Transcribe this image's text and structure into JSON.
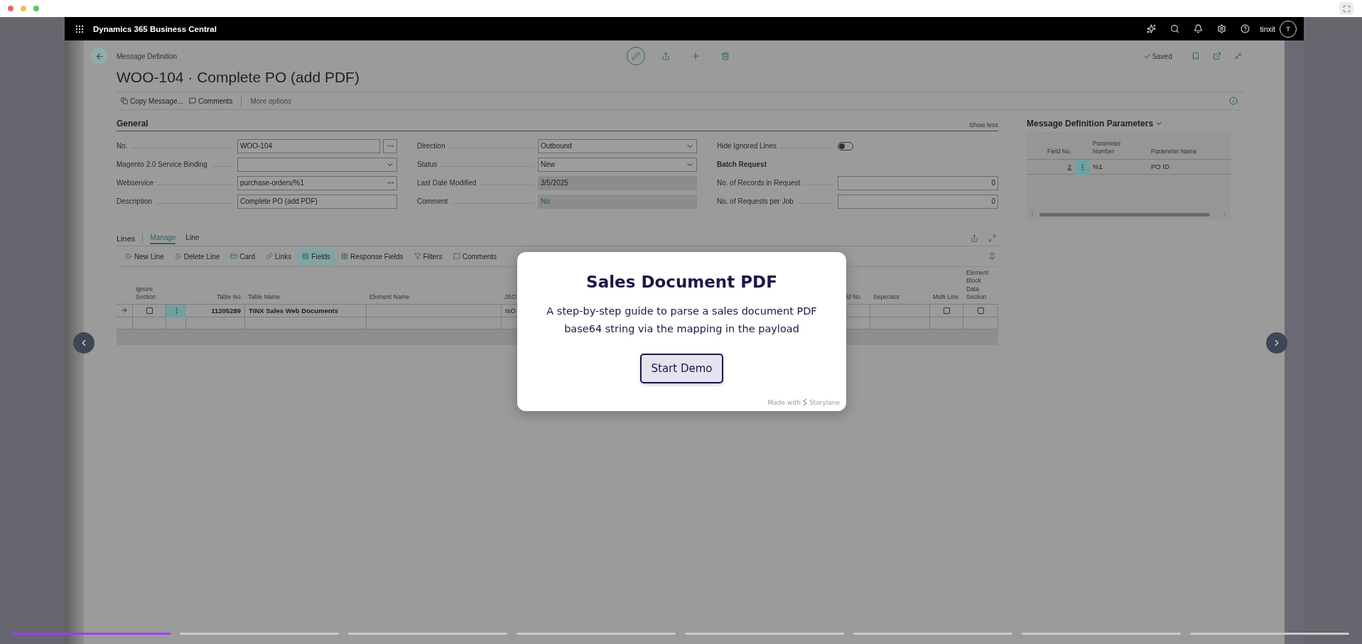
{
  "app_bar": {
    "title": "Dynamics 365 Business Central",
    "user": "tinxit",
    "avatar_initial": "T"
  },
  "page": {
    "breadcrumb": "Message Definition",
    "title": "WOO-104 · Complete PO (add PDF)",
    "status": "Saved"
  },
  "actions": [
    "Copy Message...",
    "Comments",
    "More options"
  ],
  "general": {
    "title": "General",
    "toggle_label": "Show less",
    "columns": [
      [
        {
          "label": "No.",
          "kind": "assist",
          "value": "WOO-104"
        },
        {
          "label": "Magento 2.0 Service Binding",
          "kind": "select"
        },
        {
          "label": "Webservice",
          "kind": "lookup",
          "value": "purchase-orders/%1"
        },
        {
          "label": "Description",
          "kind": "text",
          "value": "Complete PO (add PDF)"
        }
      ],
      [
        {
          "label": "Direction",
          "kind": "select",
          "value": "Outbound"
        },
        {
          "label": "Status",
          "kind": "select",
          "value": "New"
        },
        {
          "label": "Last Date Modified",
          "kind": "readonly",
          "value": "3/5/2025"
        },
        {
          "label": "Comment",
          "kind": "readonly_link",
          "value": "No"
        }
      ],
      [
        {
          "label": "Hide Ignored Lines",
          "kind": "toggle",
          "on": false
        },
        {
          "label": "Batch Request",
          "kind": "heading"
        },
        {
          "label": "No. of Records in Request",
          "kind": "number",
          "value": "0"
        },
        {
          "label": "No. of Requests per Job",
          "kind": "number",
          "value": "0"
        }
      ]
    ]
  },
  "lines": {
    "title": "Lines",
    "tabs": [
      {
        "label": "Manage",
        "selected": true
      },
      {
        "label": "Line",
        "selected": false
      }
    ],
    "actions": [
      {
        "label": "New Line",
        "selected": false
      },
      {
        "label": "Delete Line",
        "selected": false
      },
      {
        "label": "Card",
        "selected": false
      },
      {
        "label": "Links",
        "selected": false
      },
      {
        "label": "Fields",
        "selected": true
      },
      {
        "label": "Response Fields",
        "selected": false
      },
      {
        "label": "Filters",
        "selected": false
      },
      {
        "label": "Comments",
        "selected": false
      }
    ],
    "columns": [
      {
        "label": "Ignore Section",
        "kind": "check"
      },
      {
        "label": "Table No.",
        "kind": "number"
      },
      {
        "label": "Table Name",
        "kind": "strong"
      },
      {
        "label": "Element Name",
        "kind": "text"
      },
      {
        "label": "JSO",
        "kind": "text"
      },
      {
        "label": "ld No.",
        "kind": "text"
      },
      {
        "label": "Seperator",
        "kind": "text"
      },
      {
        "label": "Multi Line",
        "kind": "check"
      },
      {
        "label": "Element Block Data Section",
        "kind": "check"
      }
    ],
    "rows": [
      {
        "cells": [
          {
            "checked": false
          },
          {
            "text": "11205289"
          },
          {
            "text": "TINX Sales Web Documents"
          },
          {},
          {
            "text": "IsO"
          },
          {},
          {},
          {
            "checked": false
          },
          {
            "checked": false
          }
        ]
      }
    ]
  },
  "parameters": {
    "title": "Message Definition Parameters",
    "columns": [
      "Field No.",
      "Parameter Number",
      "Parameter Name"
    ],
    "rows": [
      [
        "2",
        "%1",
        "PO ID"
      ]
    ]
  },
  "modal": {
    "title": "Sales Document PDF",
    "description": "A step-by-step guide to parse a sales document PDF base64 string via the mapping in the payload",
    "button": "Start Demo",
    "credit": "Made with",
    "brand": "Storylane"
  },
  "progress": [
    {
      "level": 1
    },
    {
      "level": 0
    },
    {
      "level": 0
    },
    {
      "level": 0
    },
    {
      "level": 0
    },
    {
      "level": 0
    },
    {
      "level": 0
    },
    {
      "level": 0
    }
  ]
}
